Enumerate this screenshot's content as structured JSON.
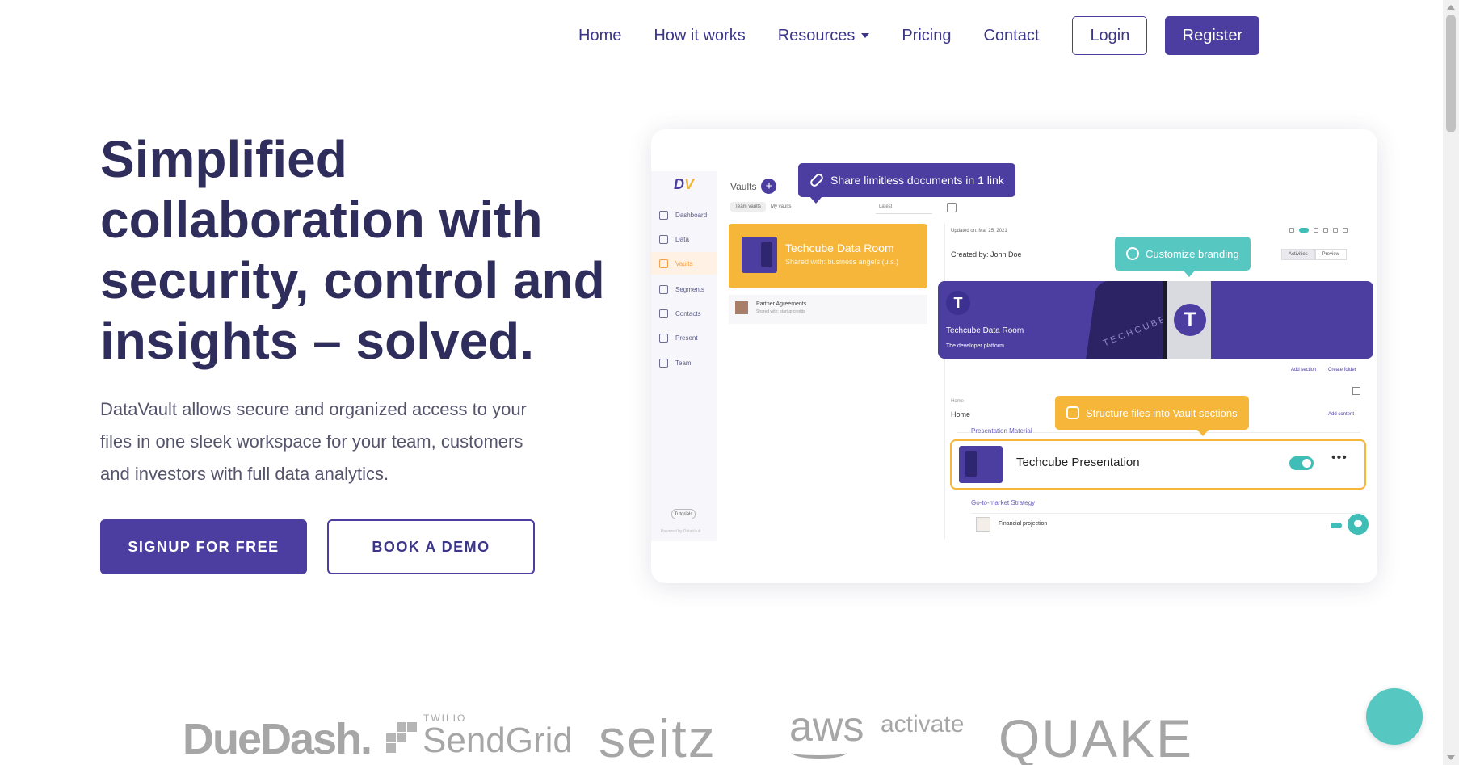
{
  "nav": {
    "items": [
      "Home",
      "How it works",
      "Resources",
      "Pricing",
      "Contact"
    ],
    "login_label": "Login",
    "register_label": "Register"
  },
  "hero": {
    "title": "Simplified collaboration with security, control and insights – solved.",
    "description": "DataVault allows secure and organized access to your files in one sleek workspace for your team, customers and investors with full data analytics.",
    "signup_label": "SIGNUP FOR FREE",
    "demo_label": "BOOK A DEMO"
  },
  "mockup": {
    "sidebar": [
      "Dashboard",
      "Data",
      "Vaults",
      "Segments",
      "Contacts",
      "Present",
      "Team"
    ],
    "tutorials_label": "Tutorials",
    "powered_label": "Powered by DataVault",
    "vaults_heading": "Vaults",
    "tabs": [
      "Team vaults",
      "My vaults"
    ],
    "sort_value": "Latest",
    "vault1": {
      "title": "Techcube Data Room",
      "shared": "Shared with: business angels (u.s.)"
    },
    "vault2": {
      "title": "Partner Agreements",
      "shared": "Shared with: startup credits"
    },
    "updated": "Updated on: Mar 25, 2021",
    "created_by": "Created by: John Doe",
    "panel_tabs": [
      "Activities",
      "Preview"
    ],
    "banner": {
      "letter": "T",
      "title": "Techcube Data Room",
      "subtitle": "The developer platform",
      "phone_word": "TECHCUBE"
    },
    "add_section": "Add section",
    "create_folder": "Create folder",
    "crumb": "Home",
    "home_label": "Home",
    "add_content": "Add content",
    "section1": "Presentation Material",
    "presentation": "Techcube Presentation",
    "section2": "Go-to-market Strategy",
    "file": "Financial projection",
    "tips": {
      "share": "Share limitless documents in 1 link",
      "branding": "Customize branding",
      "structure": "Structure files into Vault sections"
    }
  },
  "logos": {
    "duedash": "DueDash.",
    "twilio": "TWILIO",
    "sendgrid": "SendGrid",
    "seitz": "seitz",
    "aws": "aws",
    "activate": "activate",
    "quake": "QUAKE"
  },
  "colors": {
    "brand": "#4b3ea0",
    "teal": "#57c7c1",
    "amber": "#f5b63a"
  }
}
